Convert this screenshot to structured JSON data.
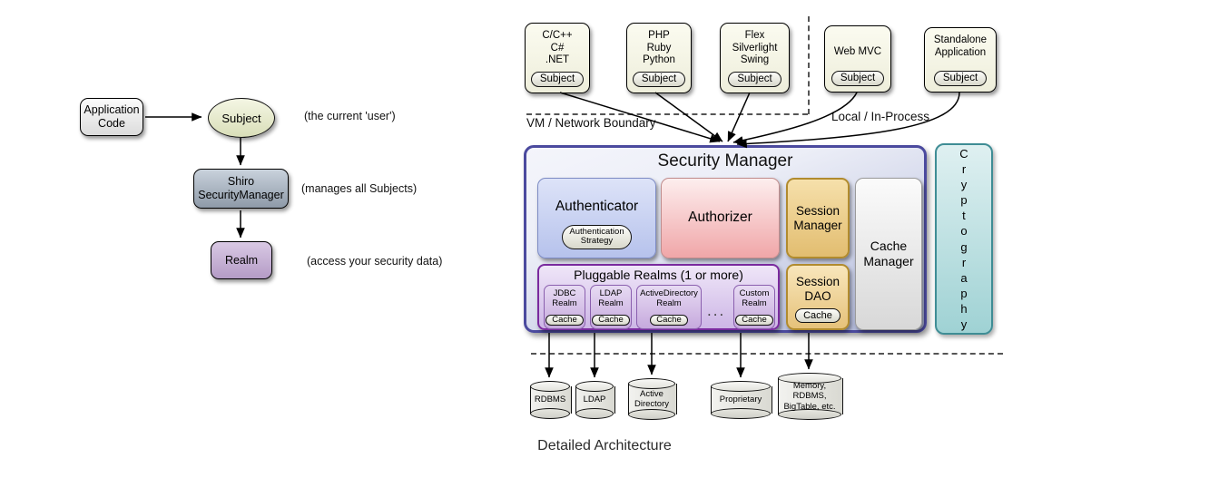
{
  "caption": "Detailed Architecture",
  "simple_diagram": {
    "application_code": "Application\nCode",
    "subject": "Subject",
    "security_manager": "Shiro\nSecurityManager",
    "realm": "Realm",
    "notes": {
      "subject": "(the current 'user')",
      "security_manager": "(manages all Subjects)",
      "realm": "(access your security data)"
    }
  },
  "detailed_diagram": {
    "clients": [
      {
        "title": "C/C++\nC#\n.NET",
        "subject": "Subject"
      },
      {
        "title": "PHP\nRuby\nPython",
        "subject": "Subject"
      },
      {
        "title": "Flex\nSilverlight\nSwing",
        "subject": "Subject"
      },
      {
        "title": "Web MVC",
        "subject": "Subject"
      },
      {
        "title": "Standalone\nApplication",
        "subject": "Subject"
      }
    ],
    "boundaries": {
      "network": "VM / Network Boundary",
      "local": "Local / In-Process"
    },
    "security_manager": {
      "title": "Security Manager",
      "authenticator": {
        "label": "Authenticator",
        "strategy": "Authentication\nStrategy"
      },
      "authorizer": {
        "label": "Authorizer"
      },
      "session_manager": {
        "label": "Session\nManager"
      },
      "session_dao": {
        "label": "Session\nDAO",
        "cache": "Cache"
      },
      "cache_manager": {
        "label": "Cache\nManager"
      },
      "realms": {
        "title": "Pluggable Realms (1 or more)",
        "ellipsis": "...",
        "items": [
          {
            "label": "JDBC\nRealm",
            "cache": "Cache"
          },
          {
            "label": "LDAP\nRealm",
            "cache": "Cache"
          },
          {
            "label": "ActiveDirectory\nRealm",
            "cache": "Cache"
          },
          {
            "label": "Custom\nRealm",
            "cache": "Cache"
          }
        ]
      }
    },
    "cryptography": {
      "label": "Cryptography",
      "letters": "C\nr\ny\np\nt\no\ng\nr\na\np\nh\ny"
    },
    "datastores": [
      {
        "label": "RDBMS"
      },
      {
        "label": "LDAP"
      },
      {
        "label": "Active\nDirectory"
      },
      {
        "label": "Proprietary"
      },
      {
        "label": "Memory,\nRDBMS,\nBigTable, etc."
      }
    ]
  },
  "colors": {
    "security_manager_border": "#4b4a9e",
    "authenticator": "#b6c2ec",
    "authorizer": "#f0a6a8",
    "session": "#e2bd70",
    "realms_border": "#7a2a9e",
    "cryptography": "#9fd2d4",
    "subject_fill": "#d9deb8",
    "realm_fill": "#b49bc6"
  }
}
